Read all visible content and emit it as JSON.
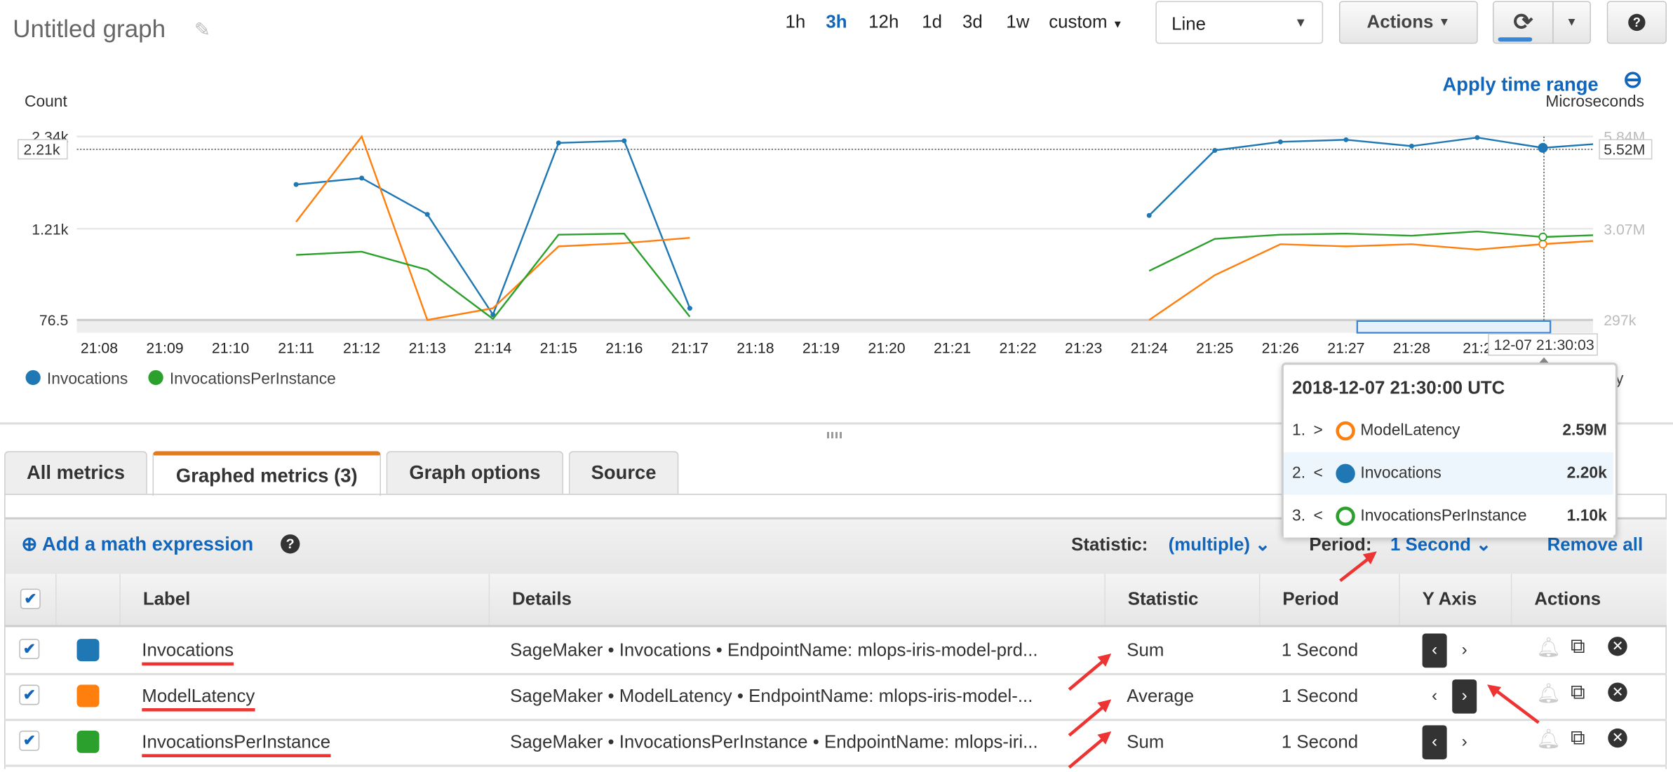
{
  "header": {
    "title": "Untitled graph",
    "time_ranges": [
      "1h",
      "3h",
      "12h",
      "1d",
      "3d",
      "1w",
      "custom"
    ],
    "active_range": "3h",
    "view_type": "Line",
    "actions_label": "Actions",
    "refresh_icon": "refresh-icon",
    "help_icon": "help-icon"
  },
  "chart_toolbar": {
    "apply_time_range": "Apply time range",
    "zoom_out_icon": "zoom-out-icon"
  },
  "chart_data": {
    "type": "line",
    "ylabel": "Count",
    "y2label": "Microseconds",
    "ylim": [
      76.5,
      2340
    ],
    "y2lim": [
      297000,
      5840000
    ],
    "y_ticks": [
      "2.34k",
      "1.21k",
      "76.5"
    ],
    "y2_ticks": [
      "5.84M",
      "3.07M",
      "297k"
    ],
    "x_ticks": [
      "21:08",
      "21:09",
      "21:10",
      "21:11",
      "21:12",
      "21:13",
      "21:14",
      "21:15",
      "21:16",
      "21:17",
      "21:18",
      "21:19",
      "21:20",
      "21:21",
      "21:22",
      "21:23",
      "21:24",
      "21:25",
      "21:26",
      "21:27",
      "21:28",
      "21:2"
    ],
    "grid": true,
    "legend_left": [
      "Invocations",
      "InvocationsPerInstance"
    ],
    "crosshair": {
      "left_value": "2.21k",
      "right_value": "5.52M",
      "time": "12-07 21:30:03"
    },
    "series": [
      {
        "name": "Invocations",
        "axis": "left",
        "color": "#1f77b4",
        "markers": true,
        "x": [
          "21:11",
          "21:12",
          "21:13",
          "21:14",
          "21:15",
          "21:16",
          "21:17",
          null,
          "21:24",
          "21:25",
          "21:26",
          "21:27",
          "21:28",
          "21:29",
          "21:30",
          "21:31"
        ],
        "values": [
          1748,
          1827,
          1379,
          142,
          2261,
          2287,
          221,
          null,
          1366,
          2169,
          2274,
          2300,
          2222,
          2327,
          2200,
          2260
        ]
      },
      {
        "name": "ModelLatency",
        "axis": "right",
        "color": "#ff7f0e",
        "markers": false,
        "x": [
          "21:11",
          "21:12",
          "21:13",
          "21:14",
          "21:15",
          "21:16",
          "21:17",
          null,
          "21:24",
          "21:25",
          "21:26",
          "21:27",
          "21:28",
          "21:29",
          "21:30",
          "21:31"
        ],
        "values": [
          3262000,
          5840000,
          297000,
          651000,
          2521000,
          2618000,
          2779000,
          null,
          297000,
          1651000,
          2585000,
          2521000,
          2585000,
          2424000,
          2590000,
          2714000
        ]
      },
      {
        "name": "InvocationsPerInstance",
        "axis": "left",
        "color": "#2ca02c",
        "markers": false,
        "x": [
          "21:11",
          "21:12",
          "21:13",
          "21:14",
          "21:15",
          "21:16",
          "21:17",
          null,
          "21:24",
          "21:25",
          "21:26",
          "21:27",
          "21:28",
          "21:29",
          "21:30",
          "21:31"
        ],
        "values": [
          879,
          919,
          695,
          90,
          1129,
          1142,
          116,
          null,
          682,
          1077,
          1129,
          1142,
          1116,
          1169,
          1100,
          1129
        ]
      }
    ]
  },
  "tooltip": {
    "title": "2018-12-07 21:30:00 UTC",
    "items": [
      {
        "index": "1.",
        "axis": ">",
        "name": "ModelLatency",
        "value": "2.59M",
        "color": "#ff7f0e",
        "filled": false
      },
      {
        "index": "2.",
        "axis": "<",
        "name": "Invocations",
        "value": "2.20k",
        "color": "#1f77b4",
        "filled": true
      },
      {
        "index": "3.",
        "axis": "<",
        "name": "InvocationsPerInstance",
        "value": "1.10k",
        "color": "#2ca02c",
        "filled": false
      }
    ]
  },
  "legend_right_partial": "y",
  "tabs": [
    "All metrics",
    "Graphed metrics (3)",
    "Graph options",
    "Source"
  ],
  "active_tab": "Graphed metrics (3)",
  "toolbar": {
    "add_math": "Add a math expression",
    "statistic_label": "Statistic:",
    "statistic_value": "(multiple)",
    "period_label": "Period:",
    "period_value": "1 Second",
    "remove_all": "Remove all"
  },
  "table": {
    "columns": [
      "Label",
      "Details",
      "Statistic",
      "Period",
      "Y Axis",
      "Actions"
    ],
    "rows": [
      {
        "label": "Invocations",
        "color": "#1f77b4",
        "details": "SageMaker • Invocations • EndpointName: mlops-iris-model-prd...",
        "statistic": "Sum",
        "period": "1 Second",
        "y_axis": "left",
        "checked": true
      },
      {
        "label": "ModelLatency",
        "color": "#ff7f0e",
        "details": "SageMaker • ModelLatency • EndpointName: mlops-iris-model-...",
        "statistic": "Average",
        "period": "1 Second",
        "y_axis": "right",
        "checked": true
      },
      {
        "label": "InvocationsPerInstance",
        "color": "#2ca02c",
        "details": "SageMaker • InvocationsPerInstance • EndpointName: mlops-iri...",
        "statistic": "Sum",
        "period": "1 Second",
        "y_axis": "left",
        "checked": true
      }
    ]
  }
}
